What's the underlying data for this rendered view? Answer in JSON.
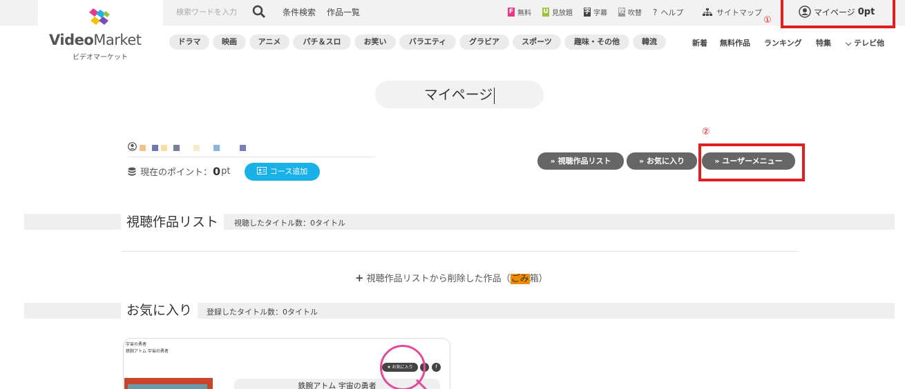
{
  "header": {
    "logo_main": "Video",
    "logo_main2": "Market",
    "logo_sub": "ビデオマーケット",
    "search_placeholder": "検索ワードを入力",
    "links": [
      "条件検索",
      "作品一覧"
    ],
    "tools": [
      {
        "badge": "F",
        "label": "無料",
        "color": "#e8388a"
      },
      {
        "badge": "U",
        "label": "見放題",
        "color": "#9ac23c"
      },
      {
        "badge": "字",
        "label": "字幕",
        "color": "#444444"
      },
      {
        "badge": "吹",
        "label": "吹替",
        "color": "#999999"
      }
    ],
    "help_label": "ヘルプ",
    "sitemap_label": "サイトマップ",
    "mypage_label": "マイページ",
    "mypage_points": "0pt"
  },
  "annotations": {
    "one": "①",
    "two": "②"
  },
  "categories": [
    "ドラマ",
    "映画",
    "アニメ",
    "パチ＆スロ",
    "お笑い",
    "バラエティ",
    "グラビア",
    "スポーツ",
    "趣味・その他",
    "韓流"
  ],
  "right_nav": [
    "新着",
    "無料作品",
    "ランキング",
    "特集",
    "テレビ他"
  ],
  "page_title": "マイページ",
  "user": {
    "points_label": "現在のポイント：",
    "points_value": "0",
    "points_unit": "pt",
    "course_button": "コース追加"
  },
  "menu_buttons": [
    "視聴作品リスト",
    "お気に入り",
    "ユーザーメニュー"
  ],
  "sections": {
    "history": {
      "title": "視聴作品リスト",
      "count": "視聴したタイトル数：0タイトル"
    },
    "trash": {
      "prefix": "視聴作品リストから削除した作品（",
      "highlight": "ごみ",
      "suffix": "箱）"
    },
    "favorites": {
      "title": "お気に入り",
      "count": "登録したタイトル数：0タイトル"
    }
  },
  "card": {
    "line1": "宇宙の勇者",
    "line2": "鉄腕アトム 宇宙の勇者",
    "fav_mini": "★ お気に入り",
    "title": "鉄腕アトム 宇宙の勇者"
  },
  "colors": {
    "accent": "#1ab0e8",
    "annotation": "#e02020",
    "menu_button": "#666666",
    "highlight": "#f08a00"
  }
}
